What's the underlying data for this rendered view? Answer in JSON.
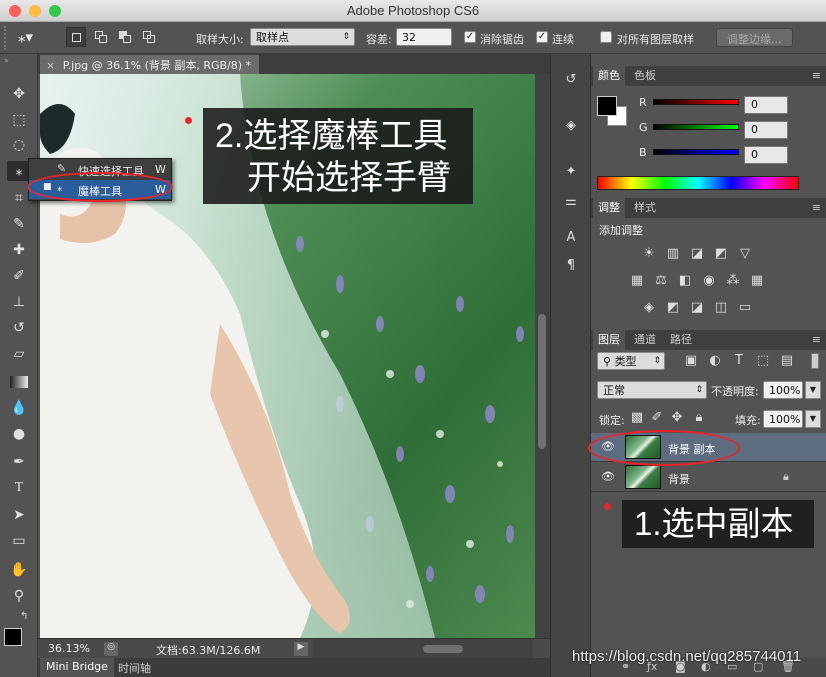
{
  "window": {
    "title": "Adobe Photoshop CS6"
  },
  "options_bar": {
    "sample_size_label": "取样大小:",
    "sample_size_value": "取样点",
    "tolerance_label": "容差:",
    "tolerance_value": "32",
    "antialias_label": "消除锯齿",
    "contiguous_label": "连续",
    "sample_all_label": "对所有图层取样",
    "refine_edge_label": "调整边缘..."
  },
  "document": {
    "tab_title": "P.jpg @ 36.1% (背景 副本, RGB/8) *",
    "zoom": "36.13%",
    "doc_info": "文档:63.3M/126.6M"
  },
  "bottom_tabs": [
    "Mini Bridge",
    "时间轴"
  ],
  "tool_flyout": {
    "items": [
      {
        "label": "快速选择工具",
        "shortcut": "W"
      },
      {
        "label": "魔棒工具",
        "shortcut": "W"
      }
    ]
  },
  "color_panel": {
    "tabs": [
      "颜色",
      "色板"
    ],
    "channels": [
      {
        "name": "R",
        "value": "0"
      },
      {
        "name": "G",
        "value": "0"
      },
      {
        "name": "B",
        "value": "0"
      }
    ]
  },
  "adjust_panel": {
    "tabs": [
      "调整",
      "样式"
    ],
    "heading": "添加调整"
  },
  "layers_panel": {
    "tabs": [
      "图层",
      "通道",
      "路径"
    ],
    "filter_kind": "类型",
    "blend_mode": "正常",
    "opacity_label": "不透明度:",
    "opacity_value": "100%",
    "lock_label": "锁定:",
    "fill_label": "填充:",
    "fill_value": "100%",
    "layers": [
      {
        "name": "背景 副本"
      },
      {
        "name": "背景"
      }
    ]
  },
  "annotations": {
    "step2_line1": "2.选择魔棒工具",
    "step2_line2": "开始选择手臂",
    "step1": "1.选中副本"
  },
  "watermark": "https://blog.csdn.net/qq285744011"
}
